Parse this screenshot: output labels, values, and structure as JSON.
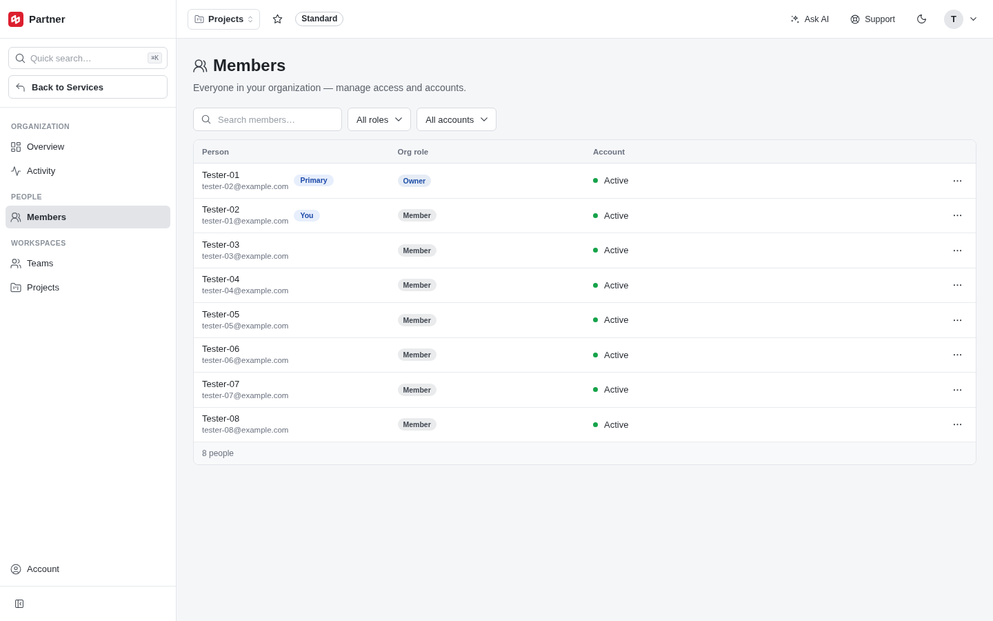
{
  "app": {
    "name": "Partner"
  },
  "sidebar": {
    "search": {
      "placeholder": "Quick search…",
      "shortcut": "⌘K"
    },
    "back_button": "Back to Services",
    "sections": [
      {
        "title": "ORGANIZATION",
        "items": [
          {
            "label": "Overview",
            "selected": false
          },
          {
            "label": "Activity",
            "selected": false
          }
        ]
      },
      {
        "title": "PEOPLE",
        "items": [
          {
            "label": "Members",
            "selected": true
          }
        ]
      },
      {
        "title": "WORKSPACES",
        "items": [
          {
            "label": "Teams",
            "selected": false
          },
          {
            "label": "Projects",
            "selected": false
          }
        ]
      }
    ],
    "footer_item": {
      "label": "Account",
      "selected": false
    }
  },
  "header": {
    "project_switcher": "Projects",
    "starred": false,
    "plan_badge": "Standard",
    "ask_ai": "Ask AI",
    "support": "Support",
    "avatar": "T"
  },
  "page": {
    "title": "Members",
    "subtitle": "Everyone in your organization — manage access and accounts.",
    "filters": {
      "search_placeholder": "Search members…",
      "dropdowns": [
        "All roles",
        "All accounts"
      ]
    }
  },
  "table": {
    "columns": [
      "Person",
      "Org role",
      "Account"
    ],
    "rows": [
      {
        "name": "Tester-01",
        "email": "tester-02@example.com",
        "tag": "Primary",
        "role": {
          "label": "Owner",
          "color": "#1e4fa8"
        },
        "account": {
          "label": "Active",
          "color": "#16a34a"
        }
      },
      {
        "name": "Tester-02",
        "email": "tester-01@example.com",
        "tag": "You",
        "role": {
          "label": "Member",
          "color": "#3f4650"
        },
        "account": {
          "label": "Active",
          "color": "#16a34a"
        }
      },
      {
        "name": "Tester-03",
        "email": "tester-03@example.com",
        "role": {
          "label": "Member",
          "color": "#3f4650"
        },
        "account": {
          "label": "Active",
          "color": "#16a34a"
        }
      },
      {
        "name": "Tester-04",
        "email": "tester-04@example.com",
        "role": {
          "label": "Member",
          "color": "#3f4650"
        },
        "account": {
          "label": "Active",
          "color": "#16a34a"
        }
      },
      {
        "name": "Tester-05",
        "email": "tester-05@example.com",
        "role": {
          "label": "Member",
          "color": "#3f4650"
        },
        "account": {
          "label": "Active",
          "color": "#16a34a"
        }
      },
      {
        "name": "Tester-06",
        "email": "tester-06@example.com",
        "role": {
          "label": "Member",
          "color": "#3f4650"
        },
        "account": {
          "label": "Active",
          "color": "#16a34a"
        }
      },
      {
        "name": "Tester-07",
        "email": "tester-07@example.com",
        "role": {
          "label": "Member",
          "color": "#3f4650"
        },
        "account": {
          "label": "Active",
          "color": "#16a34a"
        }
      },
      {
        "name": "Tester-08",
        "email": "tester-08@example.com",
        "role": {
          "label": "Member",
          "color": "#3f4650"
        },
        "account": {
          "label": "Active",
          "color": "#16a34a"
        }
      }
    ],
    "footer": "8 people"
  }
}
